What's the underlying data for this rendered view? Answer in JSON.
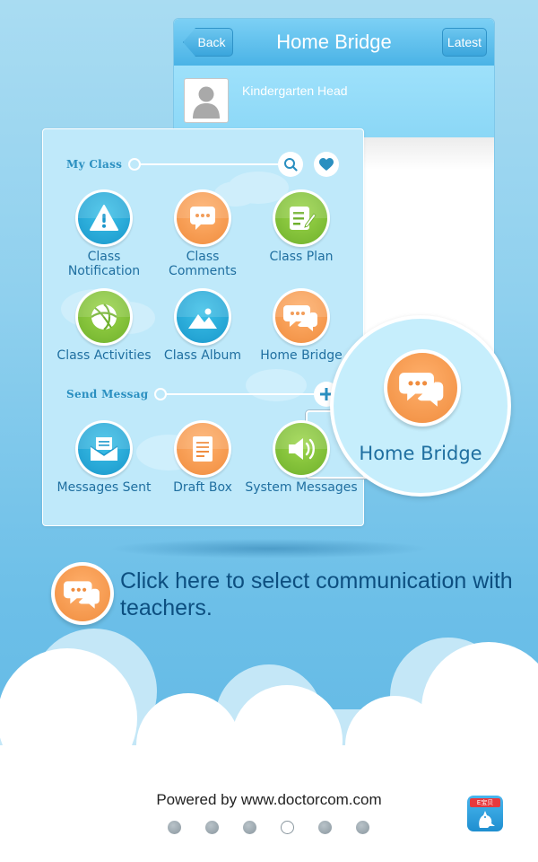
{
  "phone": {
    "back_label": "Back",
    "title": "Home Bridge",
    "latest_label": "Latest",
    "contact_name": "Kindergarten Head"
  },
  "panel": {
    "my_class_section": {
      "label": "My Class",
      "tiles": [
        {
          "label": "Class\nNotification",
          "icon": "warning-icon",
          "color": "blue"
        },
        {
          "label": "Class\nComments",
          "icon": "comment-icon",
          "color": "orange"
        },
        {
          "label": "Class Plan",
          "icon": "plan-edit-icon",
          "color": "green"
        },
        {
          "label": "Class Activities",
          "icon": "ball-icon",
          "color": "green"
        },
        {
          "label": "Class Album",
          "icon": "picture-icon",
          "color": "blue"
        },
        {
          "label": "Home Bridge",
          "icon": "chat-bubbles-icon",
          "color": "orange",
          "selected": true
        }
      ]
    },
    "send_message_section": {
      "label": "Send Messag",
      "tiles": [
        {
          "label": "Messages Sent",
          "icon": "envelope-icon",
          "color": "blue"
        },
        {
          "label": "Draft Box",
          "icon": "draft-icon",
          "color": "orange"
        },
        {
          "label": "System Messages",
          "icon": "speaker-icon",
          "color": "green"
        }
      ]
    }
  },
  "magnifier": {
    "label": "Home Bridge",
    "icon": "chat-bubbles-icon"
  },
  "instruction": {
    "text": "Click here to select communication with teachers.",
    "icon": "chat-bubbles-icon"
  },
  "footer": {
    "powered_by": "Powered by www.doctorcom.com",
    "page_count": 6,
    "active_page": 4,
    "logo_badge_text": "E宝贝"
  },
  "colors": {
    "accent_blue": "#1a97cb",
    "accent_orange": "#f08d3f",
    "accent_green": "#6fb02c",
    "text_blue": "#1f6fa0",
    "instruction_text": "#0d4f80"
  }
}
